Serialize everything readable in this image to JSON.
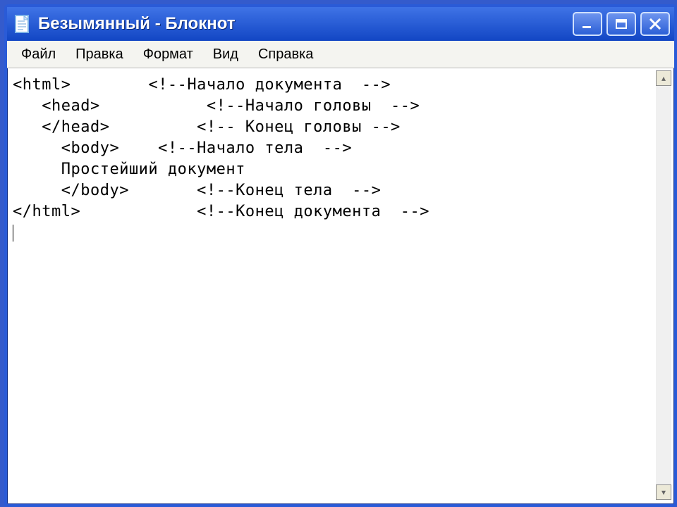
{
  "window": {
    "title": "Безымянный - Блокнот"
  },
  "menu": {
    "file": "Файл",
    "edit": "Правка",
    "format": "Формат",
    "view": "Вид",
    "help": "Справка"
  },
  "editor": {
    "text": "<html>        <!--Начало документа  -->\n   <head>           <!--Начало головы  -->\n   </head>         <!-- Конец головы -->\n     <body>    <!--Начало тела  -->\n     Простейший документ\n     </body>       <!--Конец тела  -->\n</html>            <!--Конец документа  -->\n"
  }
}
